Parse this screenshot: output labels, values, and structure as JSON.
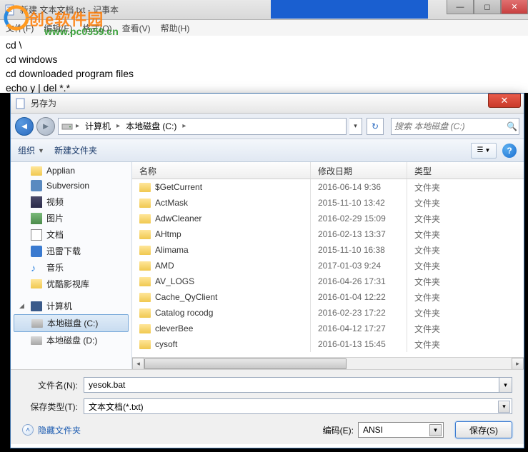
{
  "notepad": {
    "title": "新建 文本文档.txt - 记事本",
    "menu": {
      "file": "文件(F)",
      "edit": "编辑(E)",
      "format": "格式(O)",
      "view": "查看(V)",
      "help": "帮助(H)"
    },
    "body_lines": [
      "cd \\",
      "cd windows",
      "cd downloaded program files",
      "echo y | del *.*"
    ]
  },
  "watermark": {
    "brand": "创e软件园",
    "url": "www.pc0359.cn"
  },
  "saveas": {
    "title": "另存为",
    "breadcrumb": {
      "seg1": "计算机",
      "seg2": "本地磁盘 (C:)"
    },
    "search_placeholder": "搜索 本地磁盘 (C:)",
    "toolbar": {
      "organize": "组织",
      "new_folder": "新建文件夹"
    },
    "sidebar": {
      "items": [
        {
          "label": "Applian",
          "icon": "folder"
        },
        {
          "label": "Subversion",
          "icon": "subversion"
        },
        {
          "label": "视频",
          "icon": "video"
        },
        {
          "label": "图片",
          "icon": "picture"
        },
        {
          "label": "文档",
          "icon": "document"
        },
        {
          "label": "迅雷下载",
          "icon": "xunlei"
        },
        {
          "label": "音乐",
          "icon": "music"
        },
        {
          "label": "优酷影视库",
          "icon": "folder"
        }
      ],
      "computer_label": "计算机",
      "drives": [
        {
          "label": "本地磁盘 (C:)",
          "selected": true
        },
        {
          "label": "本地磁盘 (D:)",
          "selected": false
        }
      ]
    },
    "columns": {
      "name": "名称",
      "date": "修改日期",
      "type": "类型"
    },
    "files": [
      {
        "name": "$GetCurrent",
        "date": "2016-06-14 9:36",
        "type": "文件夹"
      },
      {
        "name": "ActMask",
        "date": "2015-11-10 13:42",
        "type": "文件夹"
      },
      {
        "name": "AdwCleaner",
        "date": "2016-02-29 15:09",
        "type": "文件夹"
      },
      {
        "name": "AHtmp",
        "date": "2016-02-13 13:37",
        "type": "文件夹"
      },
      {
        "name": "Alimama",
        "date": "2015-11-10 16:38",
        "type": "文件夹"
      },
      {
        "name": "AMD",
        "date": "2017-01-03 9:24",
        "type": "文件夹"
      },
      {
        "name": "AV_LOGS",
        "date": "2016-04-26 17:31",
        "type": "文件夹"
      },
      {
        "name": "Cache_QyClient",
        "date": "2016-01-04 12:22",
        "type": "文件夹"
      },
      {
        "name": "Catalog rocodg",
        "date": "2016-02-23 17:22",
        "type": "文件夹"
      },
      {
        "name": "cleverBee",
        "date": "2016-04-12 17:27",
        "type": "文件夹"
      },
      {
        "name": "cysoft",
        "date": "2016-01-13 15:45",
        "type": "文件夹"
      }
    ],
    "filename_label": "文件名(N):",
    "filename_value": "yesok.bat",
    "filetype_label": "保存类型(T):",
    "filetype_value": "文本文档(*.txt)",
    "hide_folders": "隐藏文件夹",
    "encoding_label": "编码(E):",
    "encoding_value": "ANSI",
    "save_btn": "保存(S)"
  }
}
